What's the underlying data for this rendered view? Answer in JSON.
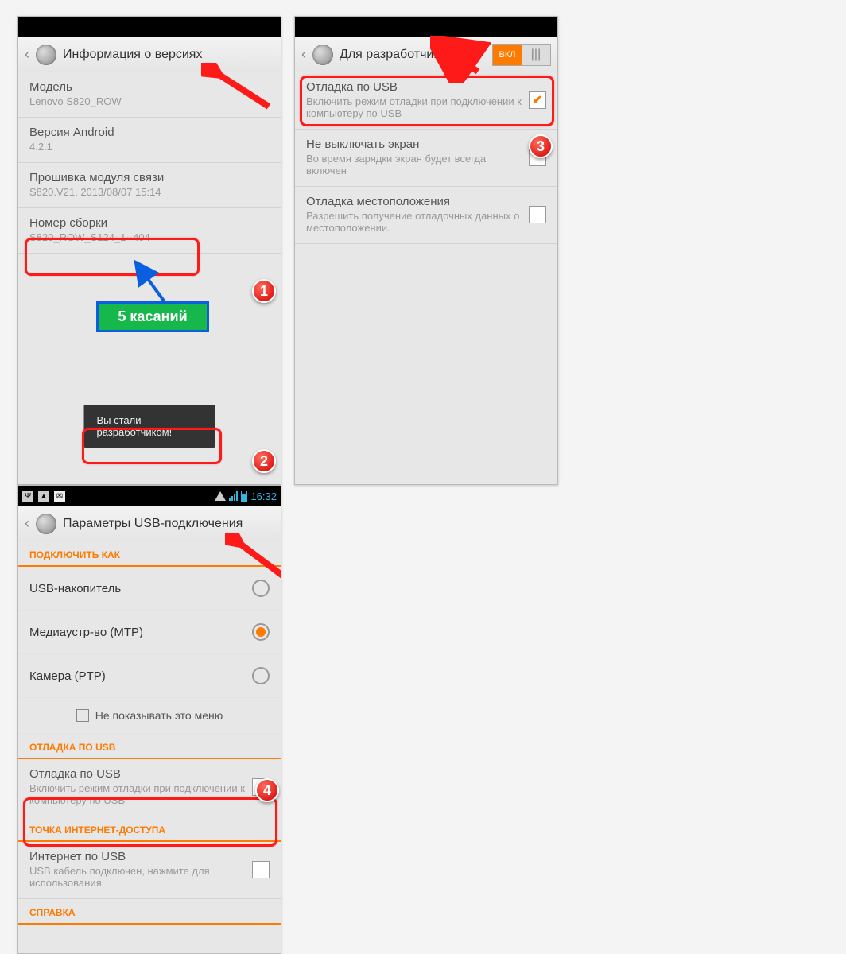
{
  "status_bar": {
    "icons": [
      "usb",
      "image",
      "mail"
    ],
    "time": "16:32"
  },
  "panel1": {
    "title": "Информация о версиях",
    "items": {
      "model_label": "Модель",
      "model_value": "Lenovo S820_ROW",
      "android_label": "Версия Android",
      "android_value": "4.2.1",
      "baseband_label": "Прошивка модуля связи",
      "baseband_value": "S820.V21, 2013/08/07 15:14",
      "build_label": "Номер сборки",
      "build_value": "S820_ROW_S124_1··404"
    },
    "hint_taps": "5 касаний",
    "toast": "Вы стали разработчиком!"
  },
  "panel2": {
    "title": "Для разработчик…",
    "toggle_on": "ВКЛ",
    "items": {
      "usb_debug_label": "Отладка по USB",
      "usb_debug_desc": "Включить режим отладки при подключении к компьютеру по USB",
      "stay_awake_label": "Не выключать экран",
      "stay_awake_desc": "Во время зарядки экран будет всегда включен",
      "mock_loc_label": "Отладка местоположения",
      "mock_loc_desc": "Разрешить получение отладочных данных о местоположении."
    }
  },
  "panel3": {
    "title": "Параметры USB-подключения",
    "section_connect": "ПОДКЛЮЧИТЬ КАК",
    "options": {
      "ums": "USB-накопитель",
      "mtp": "Медиаустр-во (MTP)",
      "ptp": "Камера (PTP)"
    },
    "dont_show": "Не показывать это меню",
    "section_debug": "ОТЛАДКА ПО USB",
    "usb_debug_label": "Отладка по USB",
    "usb_debug_desc": "Включить режим отладки при подключении к компьютеру по USB",
    "section_tether": "ТОЧКА ИНТЕРНЕТ-ДОСТУПА",
    "tether_label": "Интернет по USB",
    "tether_desc": "USB кабель подключен, нажмите для использования",
    "section_help": "СПРАВКА"
  }
}
